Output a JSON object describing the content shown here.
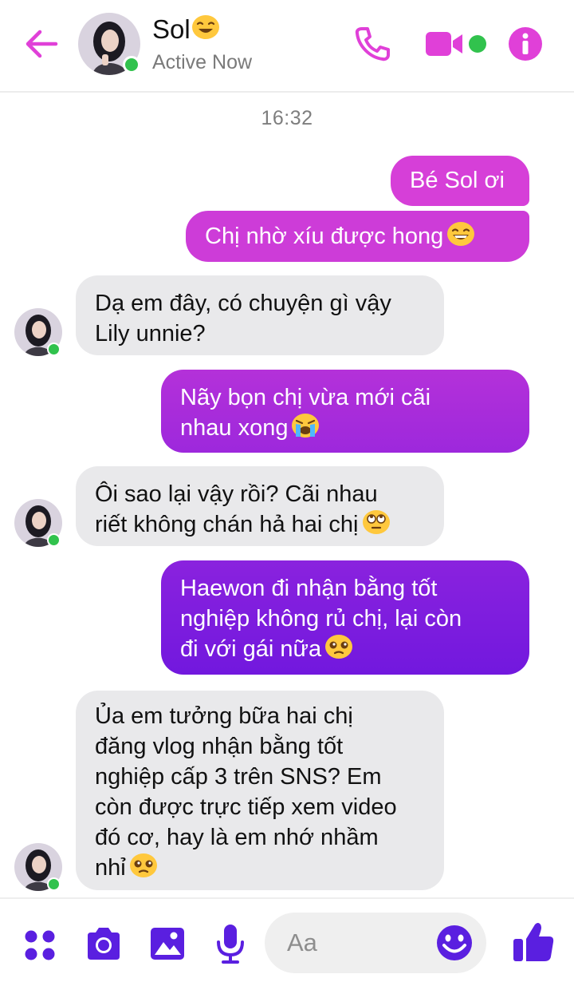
{
  "header": {
    "name": "Sol",
    "status": "Active Now",
    "name_emoji": "smiling-face-icon"
  },
  "colors": {
    "accent": "#e040d8",
    "bubble_pink": "#d23fd8",
    "bubble_purple": "#7d1fe0",
    "incoming_bubble": "#e9e9eb",
    "presence": "#31c24d",
    "bottom_icons": "#5a1fe0"
  },
  "conversation": {
    "timestamp": "16:32",
    "messages": [
      {
        "from": "me",
        "text": "Bé Sol ơi"
      },
      {
        "from": "me",
        "text": "Chị nhờ xíu được hong",
        "emoji": "grinning-face-icon"
      },
      {
        "from": "them",
        "lines": [
          "Dạ em đây, có chuyện gì vậy",
          "Lily unnie?"
        ]
      },
      {
        "from": "me",
        "lines": [
          "Nãy bọn chị vừa mới cãi",
          "nhau xong"
        ],
        "emoji": "crying-face-icon"
      },
      {
        "from": "them",
        "lines": [
          "Ôi sao lại vậy rồi? Cãi nhau",
          "riết không chán hả hai chị"
        ],
        "emoji": "rolling-eyes-face-icon"
      },
      {
        "from": "me",
        "lines": [
          "Haewon đi nhận bằng tốt",
          "nghiệp không rủ chị, lại còn",
          "đi với gái nữa"
        ],
        "emoji": "pleading-face-icon"
      },
      {
        "from": "them",
        "lines": [
          "Ủa em tưởng bữa hai chị",
          "đăng vlog nhận bằng tốt",
          "nghiệp cấp 3 trên SNS? Em",
          "còn được trực tiếp xem video",
          "đó cơ, hay là em nhớ nhầm",
          "nhỉ"
        ],
        "emoji": "pleading-face-icon"
      }
    ]
  },
  "composer": {
    "placeholder": "Aa"
  },
  "icons": {
    "back": "arrow-left-icon",
    "call": "phone-icon",
    "video": "video-camera-icon",
    "info": "info-icon",
    "apps": "four-dots-icon",
    "camera": "camera-icon",
    "gallery": "image-icon",
    "voice": "microphone-icon",
    "emoji": "smiley-icon",
    "like": "thumbs-up-icon"
  }
}
